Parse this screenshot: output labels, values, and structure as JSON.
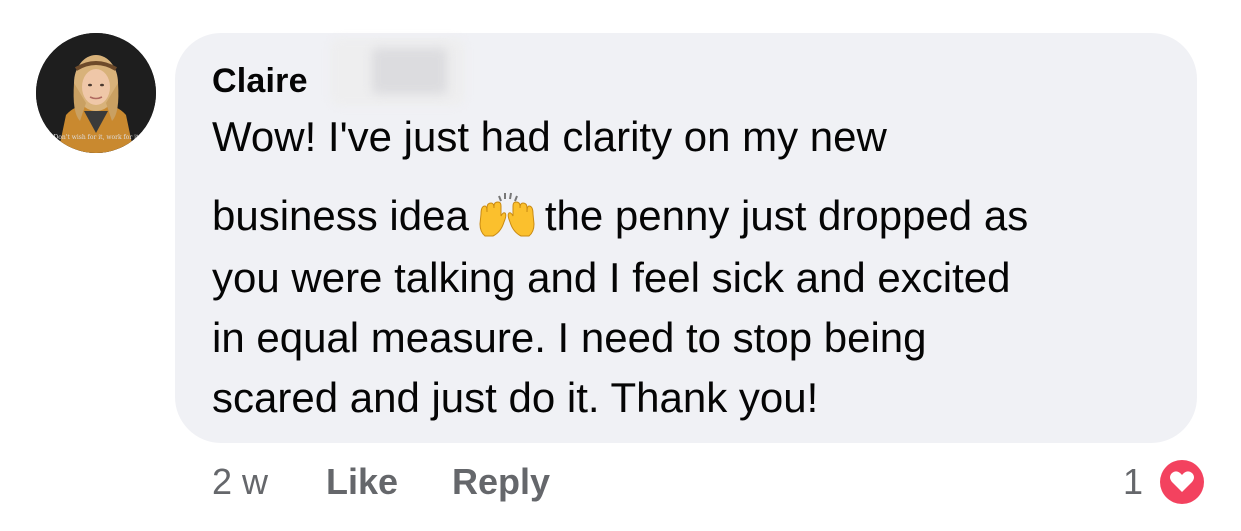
{
  "comment": {
    "author": "Claire",
    "lines": [
      "Wow! I've just had clarity on my new",
      "business idea",
      "the penny just dropped as",
      "you were talking and I feel sick and excited",
      "in equal measure. I need to stop being",
      "scared and just do it. Thank you!"
    ],
    "emoji": "raising-hands-emoji",
    "avatar_caption": "Don't wish for it, work for it"
  },
  "actions": {
    "time": "2 w",
    "like_label": "Like",
    "reply_label": "Reply"
  },
  "reactions": {
    "count": "1",
    "type": "heart-icon",
    "color": "#f3425f"
  },
  "colors": {
    "bubble": "#f0f1f5",
    "text": "#050505",
    "meta_text": "#65676b"
  }
}
